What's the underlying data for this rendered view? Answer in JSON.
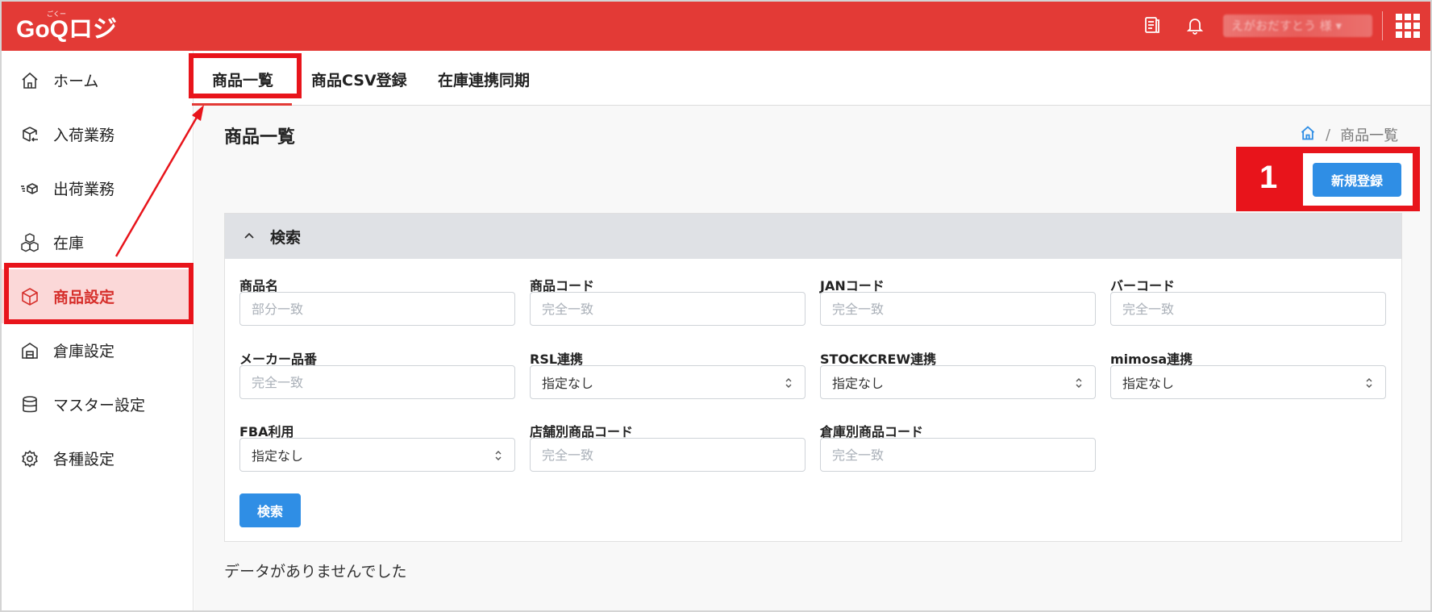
{
  "header": {
    "logo_text": "GoQロジ",
    "logo_ruby": "ごくー",
    "user_name": "えがおだすとう 様 ▾",
    "icons": [
      "manual-icon",
      "bell-icon",
      "apps-grid-icon"
    ],
    "accent_color": "#e33a36"
  },
  "sidebar": {
    "items": [
      {
        "label": "ホーム",
        "icon": "home-icon"
      },
      {
        "label": "入荷業務",
        "icon": "inbound-box-icon"
      },
      {
        "label": "出荷業務",
        "icon": "outbound-box-icon"
      },
      {
        "label": "在庫",
        "icon": "stock-boxes-icon"
      },
      {
        "label": "商品設定",
        "icon": "product-box-icon",
        "active": true
      },
      {
        "label": "倉庫設定",
        "icon": "warehouse-icon"
      },
      {
        "label": "マスター設定",
        "icon": "database-icon"
      },
      {
        "label": "各種設定",
        "icon": "gear-icon"
      }
    ]
  },
  "tabs": [
    {
      "label": "商品一覧",
      "active": true
    },
    {
      "label": "商品CSV登録"
    },
    {
      "label": "在庫連携同期"
    }
  ],
  "page": {
    "title": "商品一覧",
    "breadcrumb_current": "商品一覧",
    "new_button": "新規登録",
    "callout_number": "1",
    "empty_message": "データがありませんでした"
  },
  "search": {
    "title": "検索",
    "button": "検索",
    "fields": {
      "product_name": {
        "label": "商品名",
        "placeholder": "部分一致"
      },
      "product_code": {
        "label": "商品コード",
        "placeholder": "完全一致"
      },
      "jan_code": {
        "label": "JANコード",
        "placeholder": "完全一致"
      },
      "barcode": {
        "label": "バーコード",
        "placeholder": "完全一致"
      },
      "maker_number": {
        "label": "メーカー品番",
        "placeholder": "完全一致"
      },
      "rsl": {
        "label": "RSL連携",
        "value": "指定なし"
      },
      "stockcrew": {
        "label": "STOCKCREW連携",
        "value": "指定なし"
      },
      "mimosa": {
        "label": "mimosa連携",
        "value": "指定なし"
      },
      "fba": {
        "label": "FBA利用",
        "value": "指定なし"
      },
      "store_code": {
        "label": "店舗別商品コード",
        "placeholder": "完全一致"
      },
      "warehouse_code": {
        "label": "倉庫別商品コード",
        "placeholder": "完全一致"
      }
    }
  },
  "colors": {
    "primary_button": "#2f8ee5",
    "annotation_red": "#e8141b",
    "active_bg": "#fbd8d8"
  }
}
